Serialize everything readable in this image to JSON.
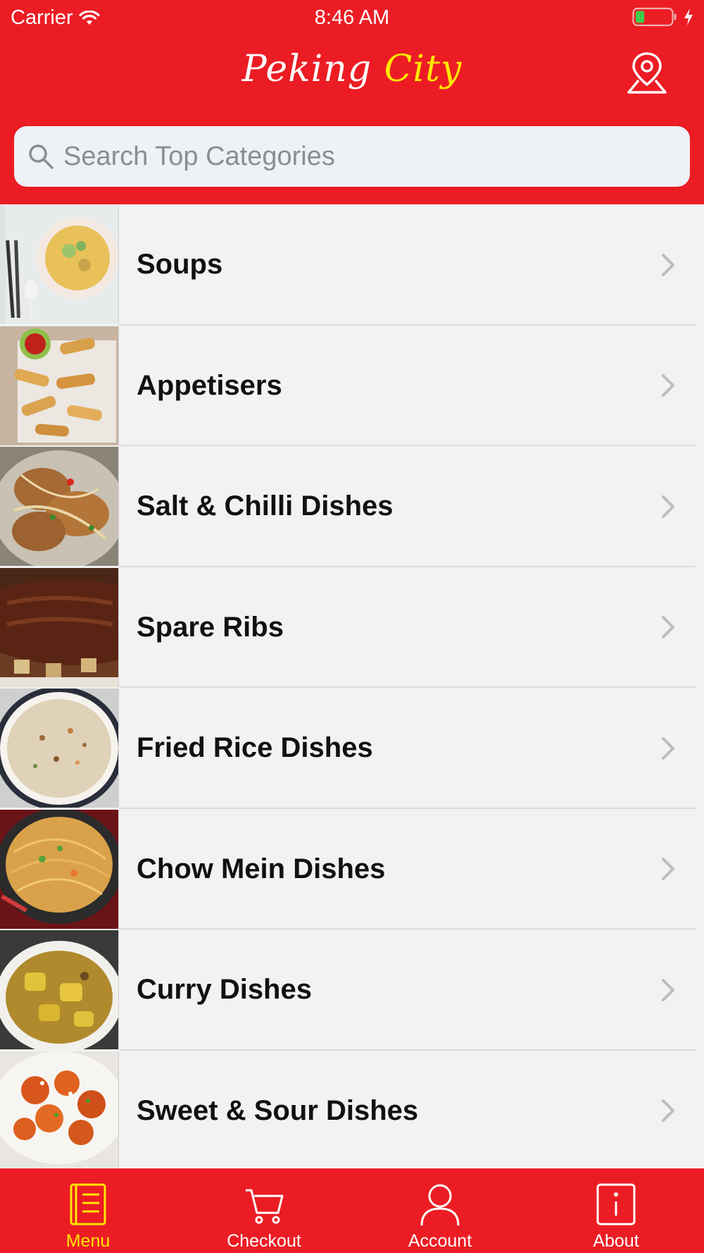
{
  "status_bar": {
    "carrier": "Carrier",
    "time": "8:46 AM",
    "battery_level": 0.25
  },
  "header": {
    "brand_part1": "Peking",
    "brand_part2": "City",
    "location_icon": "location-pin-icon"
  },
  "search": {
    "placeholder": "Search Top Categories",
    "value": ""
  },
  "categories": [
    {
      "label": "Soups",
      "image": "soup-bowl-photo"
    },
    {
      "label": "Appetisers",
      "image": "spring-rolls-photo"
    },
    {
      "label": "Salt & Chilli Dishes",
      "image": "salt-chilli-photo"
    },
    {
      "label": "Spare Ribs",
      "image": "spare-ribs-photo"
    },
    {
      "label": "Fried Rice Dishes",
      "image": "fried-rice-photo"
    },
    {
      "label": "Chow Mein Dishes",
      "image": "chow-mein-photo"
    },
    {
      "label": "Curry Dishes",
      "image": "curry-photo"
    },
    {
      "label": "Sweet & Sour Dishes",
      "image": "sweet-sour-photo"
    }
  ],
  "tabbar": {
    "tabs": [
      {
        "label": "Menu",
        "icon": "menu-book-icon",
        "active": true
      },
      {
        "label": "Checkout",
        "icon": "cart-icon",
        "active": false
      },
      {
        "label": "Account",
        "icon": "person-icon",
        "active": false
      },
      {
        "label": "About",
        "icon": "info-icon",
        "active": false
      }
    ]
  },
  "colors": {
    "brand_red": "#ec1c24",
    "accent_yellow": "#ffe600",
    "list_bg": "#f2f2f2"
  }
}
